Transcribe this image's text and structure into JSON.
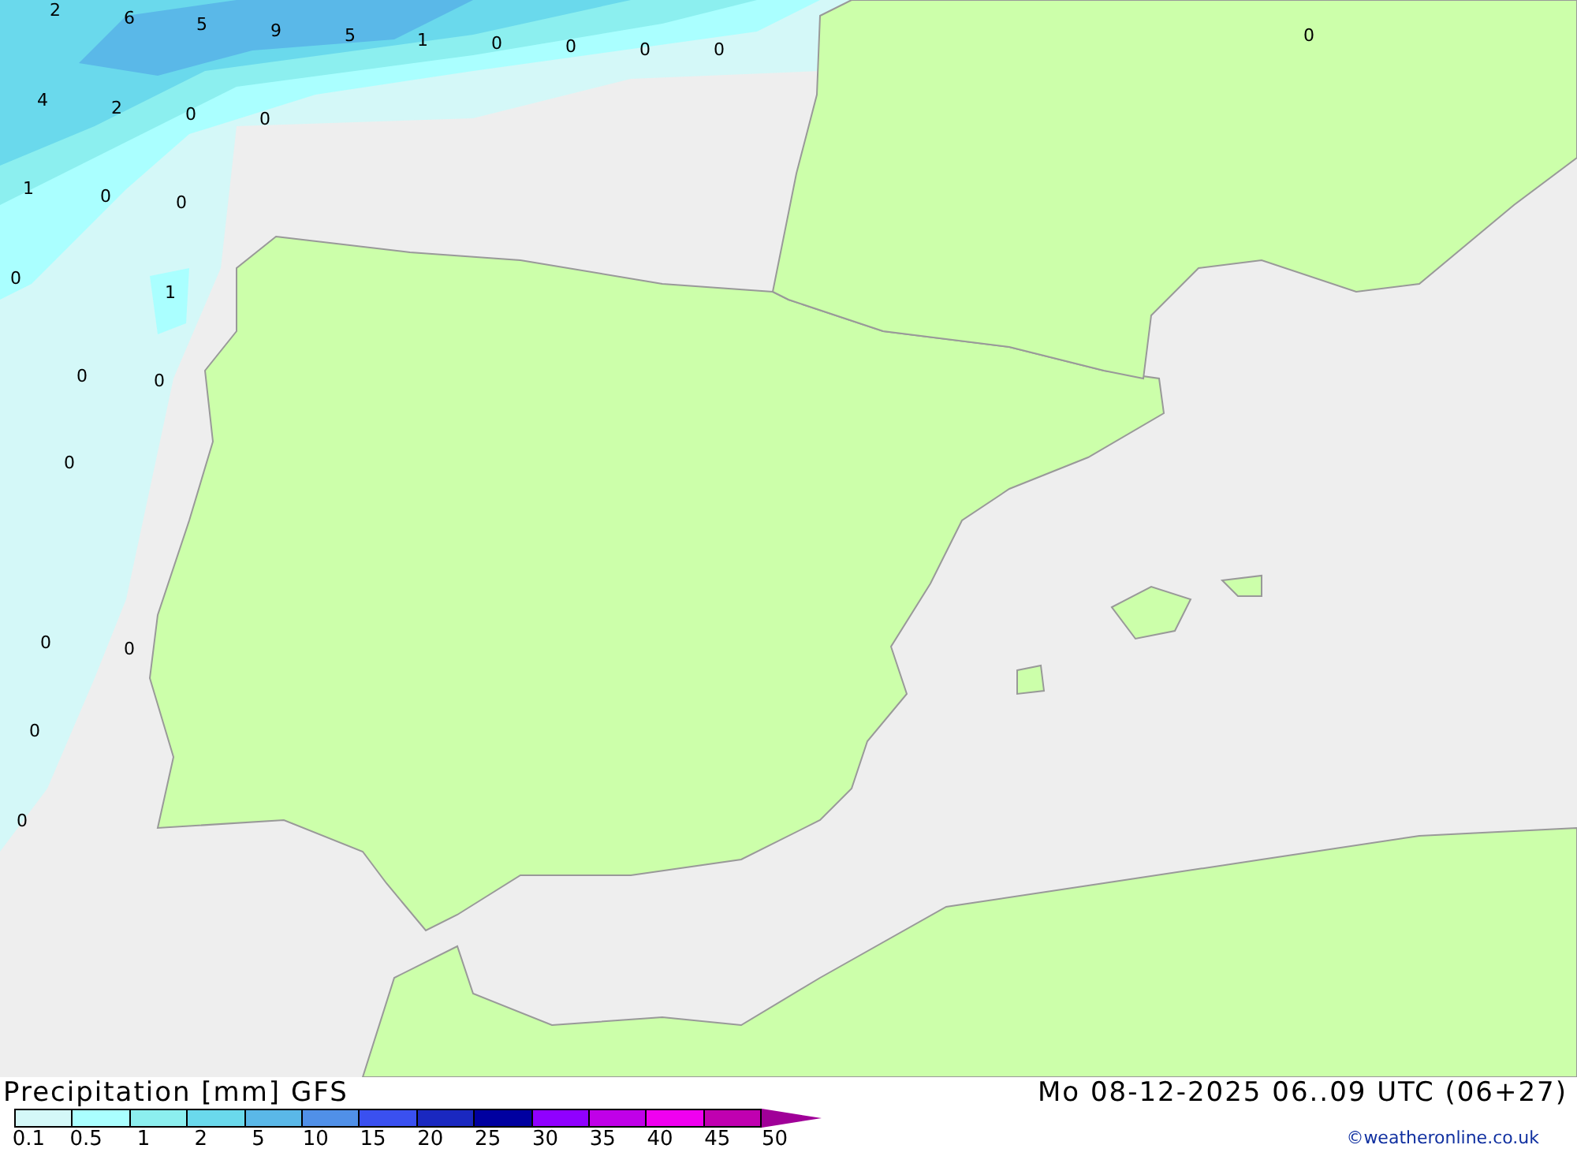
{
  "map": {
    "value_labels": [
      "2",
      "6",
      "5",
      "9",
      "5",
      "1",
      "0",
      "0",
      "0",
      "0",
      "0",
      "4",
      "2",
      "0",
      "0",
      "1",
      "0",
      "0",
      "0",
      "1",
      "0",
      "0",
      "0",
      "0",
      "0",
      "0",
      "0"
    ]
  },
  "title": "Precipitation [mm] GFS",
  "valid_time": "Mo 08-12-2025 06..09 UTC (06+27)",
  "legend": {
    "bins": [
      {
        "color": "#d4f8f8"
      },
      {
        "color": "#aaffff"
      },
      {
        "color": "#8cefef"
      },
      {
        "color": "#6ad9ec"
      },
      {
        "color": "#5ab8e8"
      },
      {
        "color": "#5090e8"
      },
      {
        "color": "#3a50f0"
      },
      {
        "color": "#1a28c0"
      },
      {
        "color": "#0000a0"
      },
      {
        "color": "#9000ff"
      },
      {
        "color": "#c000e8"
      },
      {
        "color": "#f000f0"
      },
      {
        "color": "#c000b0"
      }
    ],
    "overflow_arrow": {
      "color": "#a00098"
    },
    "ticks": [
      "0.1",
      "0.5",
      "1",
      "2",
      "5",
      "10",
      "15",
      "20",
      "25",
      "30",
      "35",
      "40",
      "45",
      "50"
    ]
  },
  "credit": "©weatheronline.co.uk"
}
